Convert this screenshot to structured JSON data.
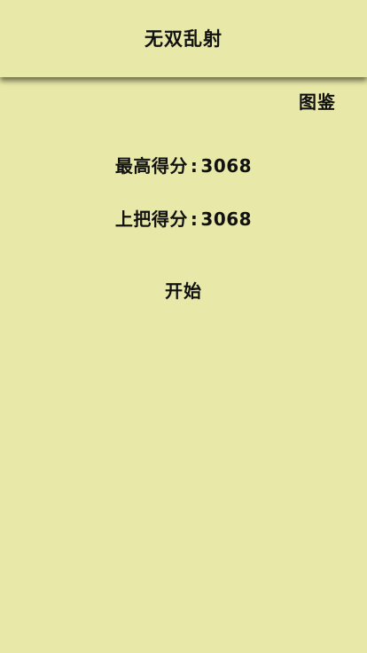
{
  "header": {
    "title": "无双乱射"
  },
  "menu": {
    "gallery_label": "图鉴",
    "start_label": "开始"
  },
  "scores": {
    "best_label": "最高得分",
    "best_value": "3068",
    "last_label": "上把得分",
    "last_value": "3068",
    "separator": ":"
  },
  "colors": {
    "background": "#e8e8a8",
    "text": "#111111"
  }
}
